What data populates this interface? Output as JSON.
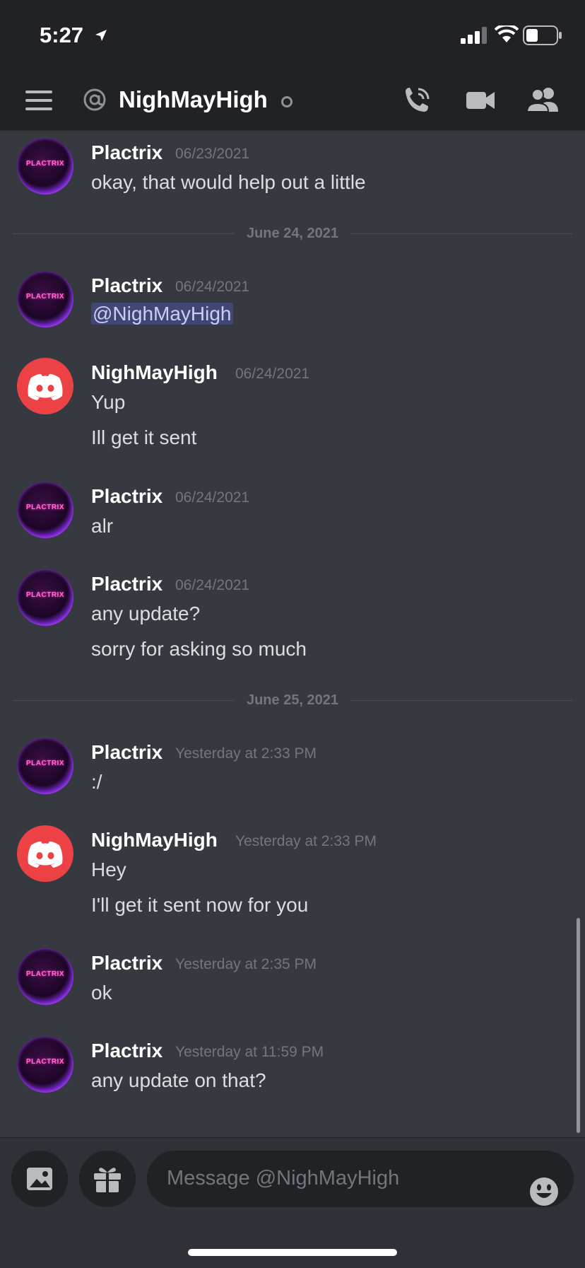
{
  "status_bar": {
    "time": "5:27"
  },
  "header": {
    "channel_title": "NighMayHigh"
  },
  "avatar_text": "PLACTRIX",
  "messages": [
    {
      "author": "Plactrix",
      "timestamp": "06/23/2021",
      "lines": [
        "okay, that would help out a little"
      ]
    },
    {
      "author": "Plactrix",
      "timestamp": "06/24/2021",
      "mention": "@NighMayHigh"
    },
    {
      "author": "NighMayHigh",
      "timestamp": "06/24/2021",
      "lines": [
        "Yup",
        "Ill get it sent"
      ]
    },
    {
      "author": "Plactrix",
      "timestamp": "06/24/2021",
      "lines": [
        "alr"
      ]
    },
    {
      "author": "Plactrix",
      "timestamp": "06/24/2021",
      "lines": [
        "any update?",
        "sorry for asking so much"
      ]
    },
    {
      "author": "Plactrix",
      "timestamp": "Yesterday at 2:33 PM",
      "lines": [
        ":/"
      ]
    },
    {
      "author": "NighMayHigh",
      "timestamp": "Yesterday at 2:33 PM",
      "lines": [
        "Hey",
        "I'll get it sent now for you"
      ]
    },
    {
      "author": "Plactrix",
      "timestamp": "Yesterday at 2:35 PM",
      "lines": [
        "ok"
      ]
    },
    {
      "author": "Plactrix",
      "timestamp": "Yesterday at 11:59 PM",
      "lines": [
        "any update on that?"
      ]
    }
  ],
  "dividers": [
    "June 24, 2021",
    "June 25, 2021"
  ],
  "composer": {
    "placeholder": "Message @NighMayHigh"
  },
  "colors": {
    "background": "#36393f",
    "header": "#202225",
    "discord_red": "#ed4245",
    "mention_bg": "#414675"
  }
}
